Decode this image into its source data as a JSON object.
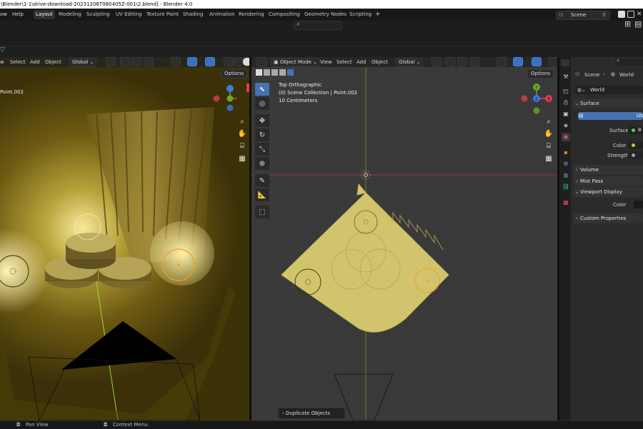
{
  "titlebar": {
    "text": "\\Blender\\1-1\\drive-download-20231206T080405Z-001\\2.blend] - Blender 4.0"
  },
  "topbar": {
    "menu": [
      "ow",
      "Help"
    ],
    "workspaces": [
      "Layout",
      "Modeling",
      "Sculpting",
      "UV Editing",
      "Texture Paint",
      "Shading",
      "Animation",
      "Rendering",
      "Compositing",
      "Geometry Nodes",
      "Scripting"
    ],
    "add_tab": "+",
    "scene_label": "Scene"
  },
  "left_view": {
    "menu": [
      "w",
      "Select",
      "Add",
      "Object"
    ],
    "orientation": "Global",
    "options_label": "Options",
    "active_label": "Point.002"
  },
  "right_view": {
    "mode": "Object Mode",
    "menu": [
      "View",
      "Select",
      "Add",
      "Object"
    ],
    "orientation": "Global",
    "options_label": "Options",
    "view_name": "Top Orthographic",
    "collection_line": "(0) Scene Collection | Point.002",
    "scale_line": "10 Centimeters",
    "last_op": "Duplicate Objects"
  },
  "gizmo": {
    "x": "X",
    "y": "Y",
    "z": "Z"
  },
  "properties": {
    "breadcrumb_scene": "Scene",
    "breadcrumb_world": "World",
    "world_name": "World",
    "surface_header": "Surface",
    "use_nodes": "Use",
    "surface_label": "Surface",
    "surface_value": "B",
    "color_label": "Color",
    "strength_label": "Strength",
    "volume_header": "Volume",
    "mist_header": "Mist Pass",
    "viewport_display_header": "Viewport Display",
    "vd_color_label": "Color",
    "custom_props_header": "Custom Properties"
  },
  "statusbar": {
    "pan_view": "Pan View",
    "context_menu": "Context Menu"
  },
  "colors": {
    "accent_blue": "#4772b3",
    "axis_red": "#e03c4c",
    "axis_green": "#6aa82c",
    "axis_blue": "#3d7be0",
    "mesh_yellow": "#d2c46c",
    "light_orange": "#f0a030"
  }
}
